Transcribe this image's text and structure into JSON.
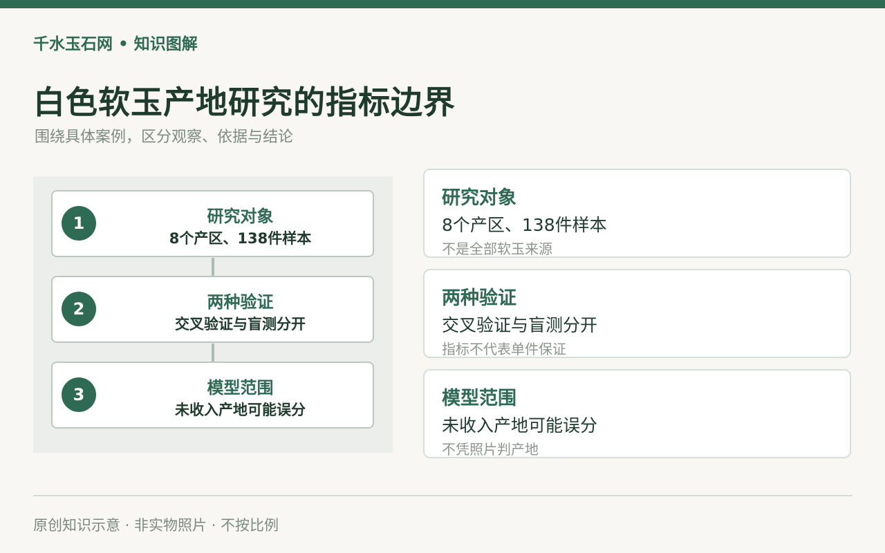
{
  "header": {
    "brand": "千水玉石网 • 知识图解",
    "title": "白色软玉产地研究的指标边界",
    "subtitle": "围绕具体案例，区分观察、依据与结论"
  },
  "flow": {
    "steps": [
      {
        "number": "1",
        "title": "研究对象",
        "desc": "8个产区、138件样本"
      },
      {
        "number": "2",
        "title": "两种验证",
        "desc": "交叉验证与盲测分开"
      },
      {
        "number": "3",
        "title": "模型范围",
        "desc": "未收入产地可能误分"
      }
    ]
  },
  "cards": [
    {
      "title": "研究对象",
      "text": "8个产区、138件样本",
      "note": "不是全部软玉来源"
    },
    {
      "title": "两种验证",
      "text": "交叉验证与盲测分开",
      "note": "指标不代表单件保证"
    },
    {
      "title": "模型范围",
      "text": "未收入产地可能误分",
      "note": "不凭照片判产地"
    }
  ],
  "footer": {
    "text": "原创知识示意 · 非实物照片 · 不按比例"
  },
  "colors": {
    "accent": "#2f6a55",
    "text_dark": "#1f3a2e",
    "muted": "#7d8a84",
    "panel_bg": "#ebeeea",
    "page_bg": "#f8f7f3"
  }
}
